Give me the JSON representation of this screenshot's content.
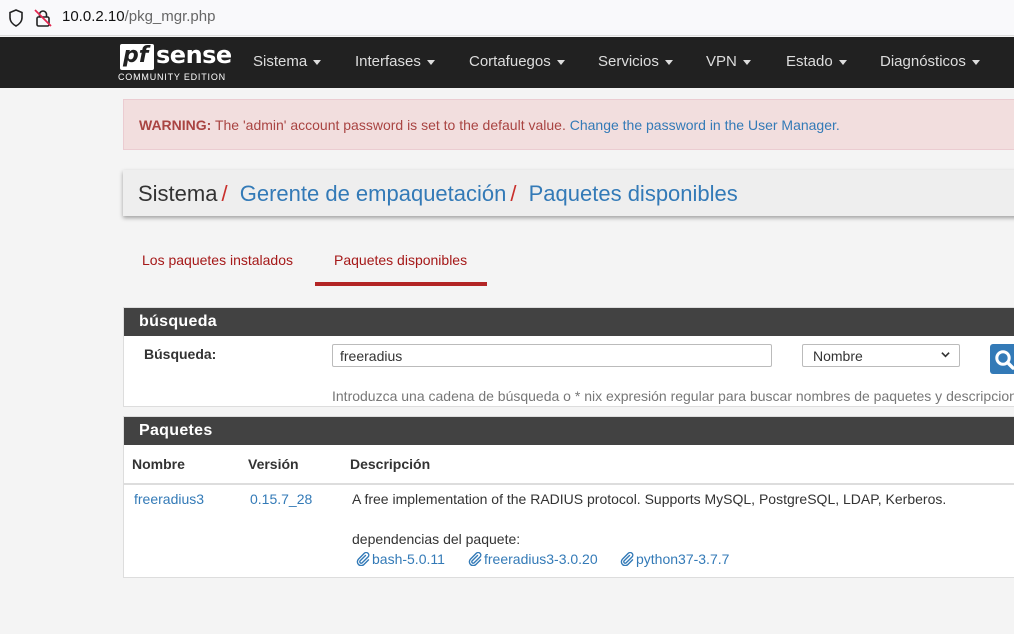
{
  "browser": {
    "url_host": "10.0.2.10",
    "url_path": "/pkg_mgr.php"
  },
  "brand": {
    "logo_pf": "pf",
    "logo_sense": "sense",
    "edition": "COMMUNITY EDITION"
  },
  "nav": {
    "items": [
      "Sistema",
      "Interfases",
      "Cortafuegos",
      "Servicios",
      "VPN",
      "Estado",
      "Diagnósticos"
    ]
  },
  "warning": {
    "label": "WARNING:",
    "text": " The 'admin' account password is set to the default value. ",
    "link": "Change the password in the User Manager."
  },
  "breadcrumb": {
    "root": "Sistema",
    "sep": "/",
    "level1": "Gerente de empaquetación",
    "level2": "Paquetes disponibles"
  },
  "tabs": {
    "installed": "Los paquetes instalados",
    "available": "Paquetes disponibles",
    "active": "available"
  },
  "search": {
    "title": "búsqueda",
    "label": "Búsqueda:",
    "value": "freeradius",
    "field_selected": "Nombre",
    "help": "Introduzca una cadena de búsqueda o * nix expresión regular para buscar nombres de paquetes y descripciones."
  },
  "packages": {
    "title": "Paquetes",
    "columns": [
      "Nombre",
      "Versión",
      "Descripción"
    ],
    "rows": [
      {
        "name": "freeradius3",
        "version": "0.15.7_28",
        "description": "A free implementation of the RADIUS protocol. Supports MySQL, PostgreSQL, LDAP, Kerberos.",
        "deps_label": "dependencias del paquete:",
        "deps": [
          "bash-5.0.11",
          "freeradius3-3.0.20",
          "python37-3.7.7"
        ]
      }
    ]
  },
  "colors": {
    "navbar": "#212121",
    "panel_heading": "#424242",
    "link": "#337ab7",
    "accent_red": "#b32525",
    "warning_bg": "#f2dede"
  }
}
